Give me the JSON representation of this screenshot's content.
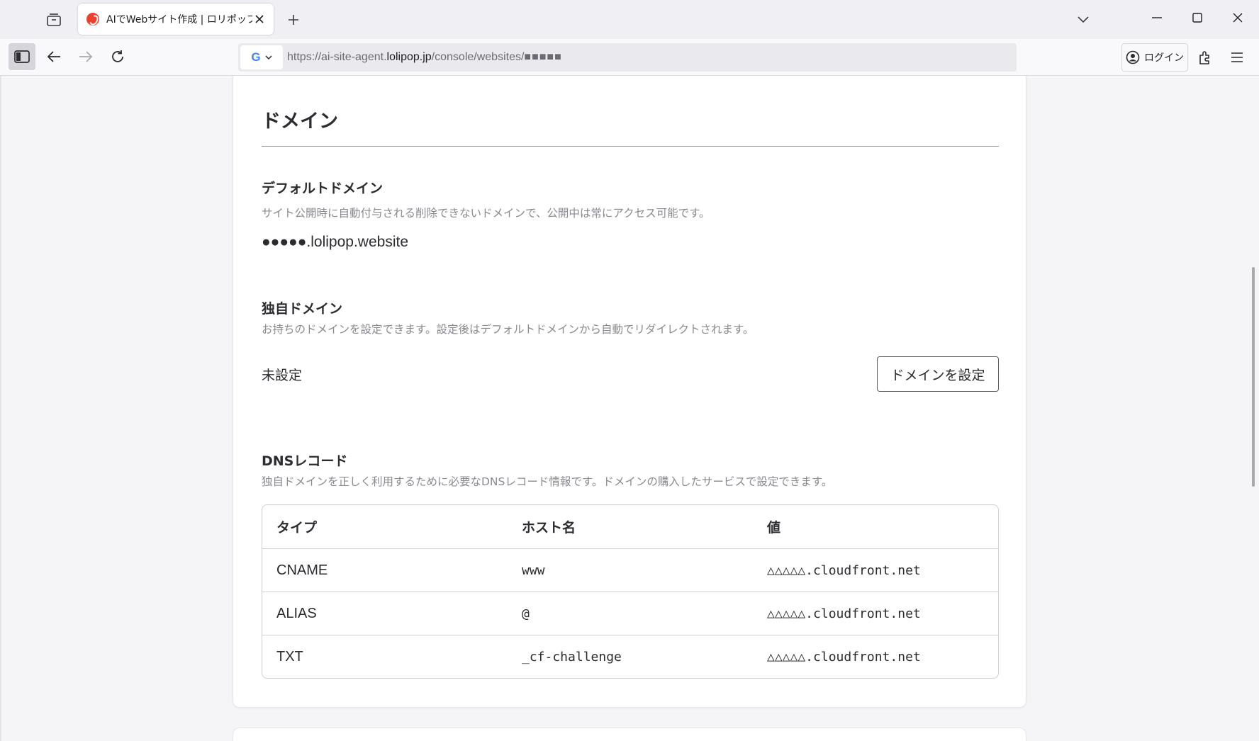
{
  "browser": {
    "tab": {
      "title": "AIでWebサイト作成 | ロリポップAIサ"
    },
    "url": {
      "prefix": "https://ai-site-agent.",
      "domain": "lolipop.jp",
      "path": "/console/websites/",
      "masked_id": "■■■■■"
    },
    "search_engine_letter": "G",
    "login_label": "ログイン"
  },
  "domain_section": {
    "title": "ドメイン",
    "default_domain": {
      "heading": "デフォルトドメイン",
      "description": "サイト公開時に自動付与される削除できないドメインで、公開中は常にアクセス可能です。",
      "value": "●●●●●.lolipop.website"
    },
    "custom_domain": {
      "heading": "独自ドメイン",
      "description": "お持ちのドメインを設定できます。設定後はデフォルトドメインから自動でリダイレクトされます。",
      "status": "未設定",
      "button_label": "ドメインを設定"
    },
    "dns_records": {
      "heading": "DNSレコード",
      "description": "独自ドメインを正しく利用するために必要なDNSレコード情報です。ドメインの購入したサービスで設定できます。",
      "columns": [
        "タイプ",
        "ホスト名",
        "値"
      ],
      "rows": [
        {
          "type": "CNAME",
          "host": "www",
          "value": "△△△△△.cloudfront.net"
        },
        {
          "type": "ALIAS",
          "host": "@",
          "value": "△△△△△.cloudfront.net"
        },
        {
          "type": "TXT",
          "host": "_cf-challenge",
          "value": "△△△△△.cloudfront.net"
        }
      ]
    }
  },
  "colors": {
    "accent_favicon": "#e8422f",
    "text_primary": "#2b2b30",
    "text_muted": "#8a8a90"
  }
}
